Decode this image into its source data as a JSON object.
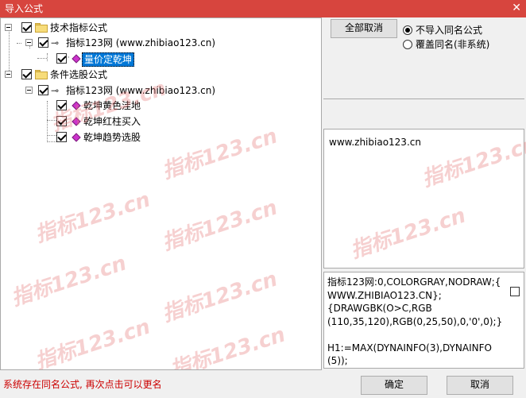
{
  "window": {
    "title": "导入公式",
    "close_glyph": "✕"
  },
  "tree": [
    {
      "id": "root1",
      "label": "技术指标公式",
      "icon": "folder-icon"
    },
    {
      "id": "group1",
      "label": "指标123网 (www.zhibiao123.cn)",
      "icon": "key-icon"
    },
    {
      "id": "item1",
      "label": "量价定乾坤",
      "icon": "formula-gem-icon",
      "selected": true
    },
    {
      "id": "root2",
      "label": "条件选股公式",
      "icon": "folder-icon"
    },
    {
      "id": "group2",
      "label": "指标123网 (www.zhibiao123.cn)",
      "icon": "key-icon"
    },
    {
      "id": "item2",
      "label": "乾坤黄色洼地",
      "icon": "formula-gem-icon"
    },
    {
      "id": "item3",
      "label": "乾坤红柱买入",
      "icon": "formula-gem-icon"
    },
    {
      "id": "item4",
      "label": "乾坤趋势选股",
      "icon": "formula-gem-icon"
    }
  ],
  "buttons": {
    "cancel_all": "全部取消",
    "ok": "确定",
    "cancel": "取消"
  },
  "options": {
    "no_import": "不导入同名公式",
    "overwrite": "覆盖同名(非系统)",
    "selected": "no_import"
  },
  "info_url": "www.zhibiao123.cn",
  "code": "指标123网:0,COLORGRAY,NODRAW;{\nWWW.ZHIBIAO123.CN};\n{DRAWGBK(O>C,RGB\n(110,35,120),RGB(0,25,50),0,'0',0);}\n\nH1:=MAX(DYNAINFO(3),DYNAINFO\n(5));",
  "status_message": "系统存在同名公式, 再次点击可以更名",
  "watermark": "指标123.cn",
  "colors": {
    "titlebar": "#d7453e",
    "selected": "#0078d7",
    "status": "#cc0000"
  }
}
